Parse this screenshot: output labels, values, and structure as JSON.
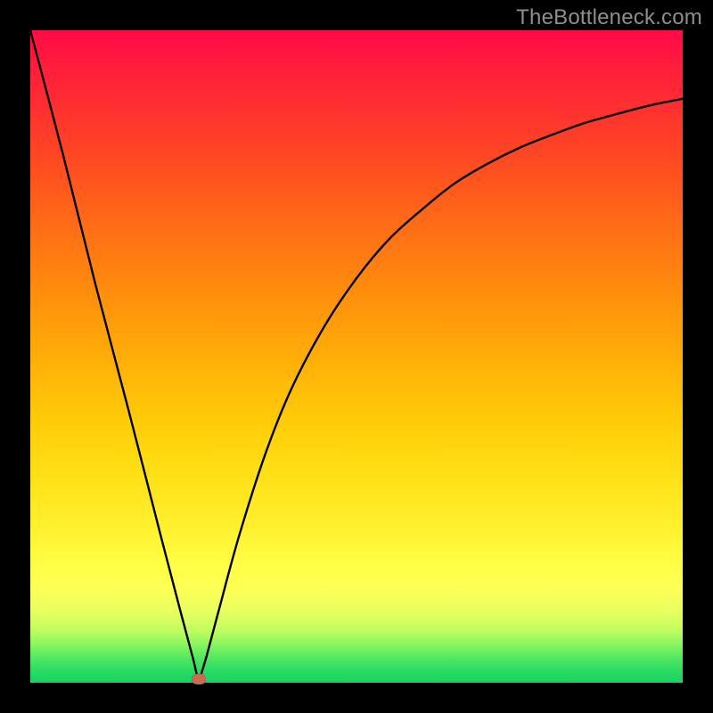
{
  "watermark": "TheBottleneck.com",
  "marker": {
    "x_frac": 0.258,
    "y_frac": 0.993
  },
  "chart_data": {
    "type": "line",
    "title": "",
    "xlabel": "",
    "ylabel": "",
    "xlim": [
      0,
      1
    ],
    "ylim": [
      0,
      1
    ],
    "grid": false,
    "legend": false,
    "series": [
      {
        "name": "curve",
        "x": [
          0.0,
          0.05,
          0.1,
          0.15,
          0.2,
          0.23,
          0.25,
          0.258,
          0.27,
          0.29,
          0.32,
          0.36,
          0.4,
          0.45,
          0.5,
          0.55,
          0.6,
          0.65,
          0.7,
          0.75,
          0.8,
          0.85,
          0.9,
          0.95,
          1.0
        ],
        "y": [
          1.0,
          0.81,
          0.61,
          0.42,
          0.225,
          0.11,
          0.035,
          0.0,
          0.04,
          0.115,
          0.225,
          0.35,
          0.45,
          0.545,
          0.62,
          0.68,
          0.725,
          0.765,
          0.795,
          0.82,
          0.84,
          0.858,
          0.872,
          0.885,
          0.895
        ]
      }
    ],
    "annotations": [
      {
        "name": "minimum-marker",
        "x": 0.258,
        "y": 0.0
      }
    ],
    "background_gradient": {
      "direction": "vertical",
      "stops": [
        {
          "pos": 0.0,
          "color": "#ff0b46"
        },
        {
          "pos": 0.5,
          "color": "#ffb408"
        },
        {
          "pos": 0.82,
          "color": "#ffff45"
        },
        {
          "pos": 1.0,
          "color": "#17d264"
        }
      ]
    }
  }
}
